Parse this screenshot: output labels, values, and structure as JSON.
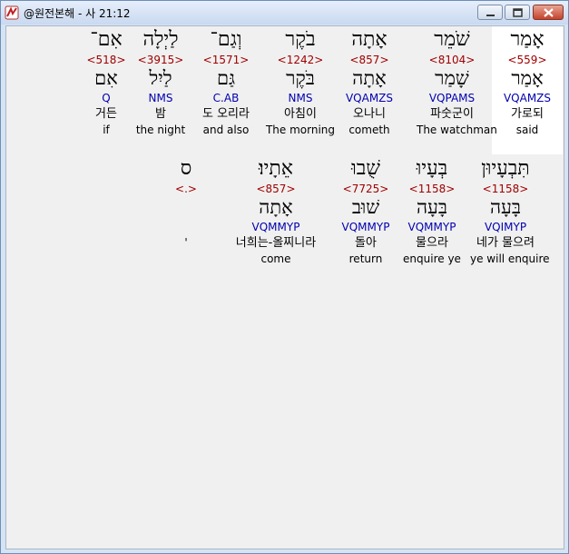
{
  "window": {
    "title": "@원전본해 - 사 21:12"
  },
  "verse_line1": [
    {
      "hebrew": "אָמַר",
      "strongs": "<559>",
      "lemma": "אָמַר",
      "morph": "VQAMZS",
      "korean": "가로되",
      "english": "said",
      "selected": true
    },
    {
      "hebrew": "שֹׁמֵר",
      "strongs": "<8104>",
      "lemma": "שָׁמַר",
      "morph": "VQPAMS",
      "korean": "파숫군이",
      "english": "The watchman"
    },
    {
      "hebrew": "אָתָה",
      "strongs": "<857>",
      "lemma": "אָתָה",
      "morph": "VQAMZS",
      "korean": "오나니",
      "english": "cometh"
    },
    {
      "hebrew": "בֹקֶר",
      "strongs": "<1242>",
      "lemma": "בֹּקֶר",
      "morph": "NMS",
      "korean": "아침이",
      "english": "The morning"
    },
    {
      "hebrew": "וְגַם־",
      "strongs": "<1571>",
      "lemma": "גַּם",
      "morph": "C.AB",
      "korean": "도 오리라",
      "english": "and also"
    },
    {
      "hebrew": "לַיְלָה",
      "strongs": "<3915>",
      "lemma": "לַיִל",
      "morph": "NMS",
      "korean": "밤",
      "english": "the night"
    },
    {
      "hebrew": "אִם־",
      "strongs": "<518>",
      "lemma": "אִם",
      "morph": "Q",
      "korean": "거든",
      "english": "if"
    }
  ],
  "verse_line2": [
    {
      "hebrew": "תִּבְעָיוּן",
      "strongs": "<1158>",
      "lemma": "בָּעָה",
      "morph": "VQIMYP",
      "korean": "네가 물으려",
      "english": "ye will enquire"
    },
    {
      "hebrew": "בְּעָיוּ",
      "strongs": "<1158>",
      "lemma": "בָּעָה",
      "morph": "VQMMYP",
      "korean": "물으라",
      "english": "enquire ye"
    },
    {
      "hebrew": "שֻׁבוּ",
      "strongs": "<7725>",
      "lemma": "שׁוּב",
      "morph": "VQMMYP",
      "korean": "돌아",
      "english": "return"
    },
    {
      "hebrew": "אֵתָיוּ׃",
      "strongs": "<857>",
      "lemma": "אָתָה",
      "morph": "VQMMYP",
      "korean": "너희는-올찌니라",
      "english": "come"
    },
    {
      "hebrew": "ס",
      "strongs": "<.>",
      "lemma": "",
      "morph": "",
      "korean": "",
      "english": "'"
    }
  ]
}
